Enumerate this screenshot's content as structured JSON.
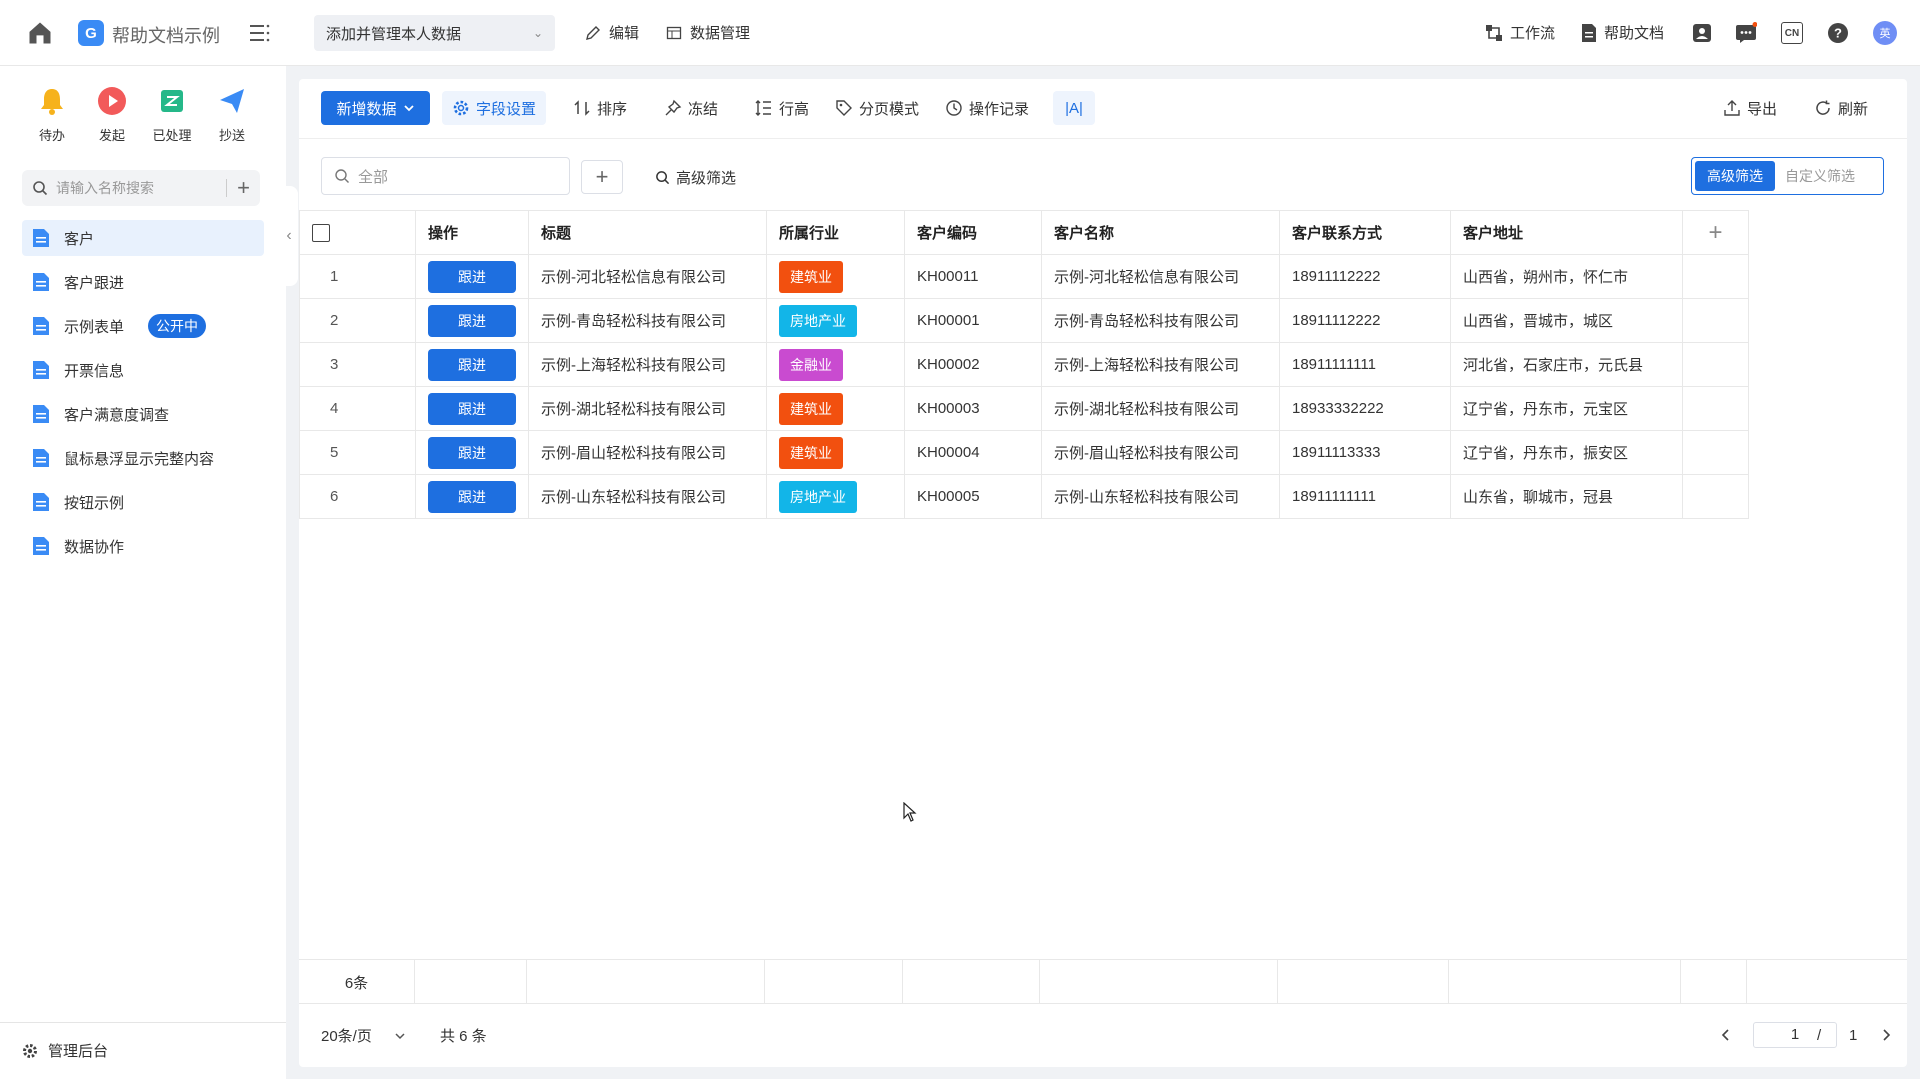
{
  "app": {
    "name": "帮助文档示例"
  },
  "topbar": {
    "view_select": "添加并管理本人数据",
    "edit_label": "编辑",
    "data_mgmt_label": "数据管理",
    "workflow_label": "工作流",
    "help_label": "帮助文档",
    "lang_label": "CN",
    "avatar_text": "英"
  },
  "sidebar": {
    "quick": [
      {
        "label": "待办",
        "color": "#f6b21c"
      },
      {
        "label": "发起",
        "color": "#f25a5a"
      },
      {
        "label": "已处理",
        "color": "#25b889"
      },
      {
        "label": "抄送",
        "color": "#3a8bf5"
      }
    ],
    "search_placeholder": "请输入名称搜索",
    "items": [
      {
        "label": "客户",
        "active": true
      },
      {
        "label": "客户跟进"
      },
      {
        "label": "示例表单",
        "badge": "公开中"
      },
      {
        "label": "开票信息"
      },
      {
        "label": "客户满意度调查"
      },
      {
        "label": "鼠标悬浮显示完整内容"
      },
      {
        "label": "按钮示例"
      },
      {
        "label": "数据协作"
      }
    ],
    "admin_label": "管理后台"
  },
  "toolbar": {
    "add_label": "新增数据",
    "field_settings": "字段设置",
    "sort": "排序",
    "freeze": "冻结",
    "row_height": "行高",
    "paging_mode": "分页模式",
    "op_log": "操作记录",
    "font_toggle": "|A|",
    "export": "导出",
    "refresh": "刷新"
  },
  "filter": {
    "search_placeholder": "全部",
    "advanced_label": "高级筛选",
    "seg_advanced": "高级筛选",
    "seg_custom": "自定义筛选"
  },
  "table": {
    "headers": [
      "操作",
      "标题",
      "所属行业",
      "客户编码",
      "客户名称",
      "客户联系方式",
      "客户地址"
    ],
    "follow_label": "跟进",
    "rows": [
      {
        "no": "1",
        "title": "示例-河北轻松信息有限公司",
        "industry": "建筑业",
        "industry_color": "#f2500f",
        "code": "KH00011",
        "name": "示例-河北轻松信息有限公司",
        "phone": "18911112222",
        "address": "山西省，朔州市，怀仁市"
      },
      {
        "no": "2",
        "title": "示例-青岛轻松科技有限公司",
        "industry": "房地产业",
        "industry_color": "#12b5e8",
        "code": "KH00001",
        "name": "示例-青岛轻松科技有限公司",
        "phone": "18911112222",
        "address": "山西省，晋城市，城区"
      },
      {
        "no": "3",
        "title": "示例-上海轻松科技有限公司",
        "industry": "金融业",
        "industry_color": "#c94bd0",
        "code": "KH00002",
        "name": "示例-上海轻松科技有限公司",
        "phone": "18911111111",
        "address": "河北省，石家庄市，元氏县"
      },
      {
        "no": "4",
        "title": "示例-湖北轻松科技有限公司",
        "industry": "建筑业",
        "industry_color": "#f2500f",
        "code": "KH00003",
        "name": "示例-湖北轻松科技有限公司",
        "phone": "18933332222",
        "address": "辽宁省，丹东市，元宝区"
      },
      {
        "no": "5",
        "title": "示例-眉山轻松科技有限公司",
        "industry": "建筑业",
        "industry_color": "#f2500f",
        "code": "KH00004",
        "name": "示例-眉山轻松科技有限公司",
        "phone": "18911113333",
        "address": "辽宁省，丹东市，振安区"
      },
      {
        "no": "6",
        "title": "示例-山东轻松科技有限公司",
        "industry": "房地产业",
        "industry_color": "#12b5e8",
        "code": "KH00005",
        "name": "示例-山东轻松科技有限公司",
        "phone": "18911111111",
        "address": "山东省，聊城市，冠县"
      }
    ],
    "summary_count": "6条"
  },
  "pager": {
    "page_size": "20条/页",
    "total": "共 6 条",
    "current": "1",
    "slash": "/",
    "pages": "1"
  }
}
